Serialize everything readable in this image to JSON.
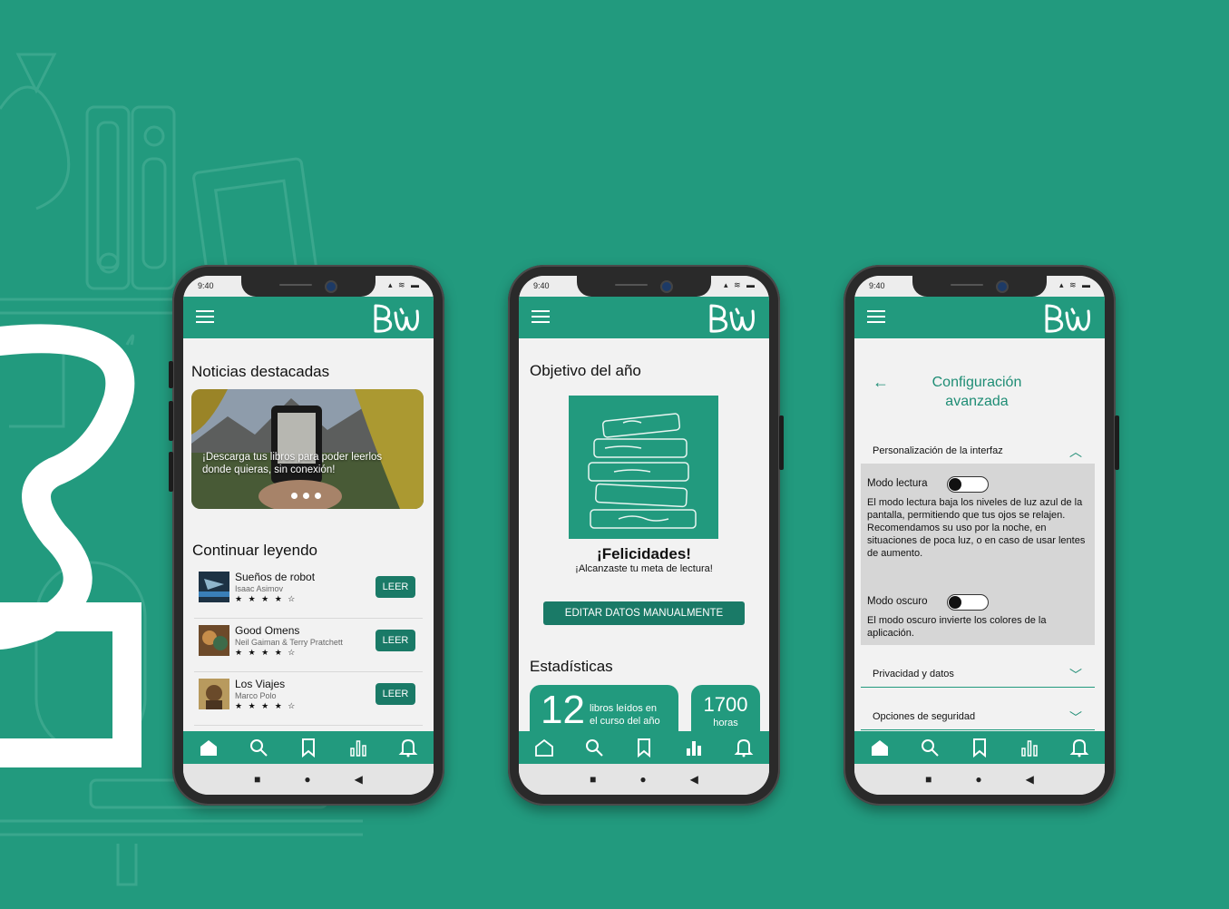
{
  "phone1": {
    "status_time": "9:40",
    "section_news": "Noticias destacadas",
    "banner_text": "¡Descarga tus libros para poder leerlos donde quieras, sin conexión!",
    "section_continue": "Continuar leyendo",
    "books": [
      {
        "title": "Sueños de robot",
        "author": "Isaac Asimov",
        "stars": "★ ★ ★ ★ ☆",
        "button": "LEER"
      },
      {
        "title": "Good Omens",
        "author": "Neil Gaiman & Terry Pratchett",
        "stars": "★ ★ ★ ★ ☆",
        "button": "LEER"
      },
      {
        "title": "Los Viajes",
        "author": "Marco Polo",
        "stars": "★ ★ ★ ★ ☆",
        "button": "LEER"
      }
    ]
  },
  "phone2": {
    "status_time": "9:40",
    "section_goal": "Objetivo del año",
    "congrats_title": "¡Felicidades!",
    "congrats_sub": "¡Alcanzaste tu meta de lectura!",
    "edit_button": "EDITAR DATOS MANUALMENTE",
    "section_stats": "Estadísticas",
    "stat_books_value": "12",
    "stat_books_label_1": "libros leídos en",
    "stat_books_label_2": "el curso del año",
    "stat_hours_value": "1700",
    "stat_hours_label": "horas"
  },
  "phone3": {
    "status_time": "9:40",
    "title_line1": "Configuración",
    "title_line2": "avanzada",
    "accordion_personal": "Personalización de la interfaz",
    "reading_mode_label": "Modo lectura",
    "reading_mode_desc": "El modo lectura baja los niveles de luz azul de la pantalla, permitiendo que tus ojos se relajen. Recomendamos su uso por la noche, en situaciones de poca luz, o en caso de usar lentes de aumento.",
    "dark_mode_label": "Modo oscuro",
    "dark_mode_desc": "El modo oscuro invierte los colores de la aplicación.",
    "accordion_privacy": "Privacidad y datos",
    "accordion_security": "Opciones de seguridad"
  },
  "colors": {
    "brand": "#229a7e",
    "button": "#1a7a67",
    "screen_bg": "#f2f2f2"
  }
}
